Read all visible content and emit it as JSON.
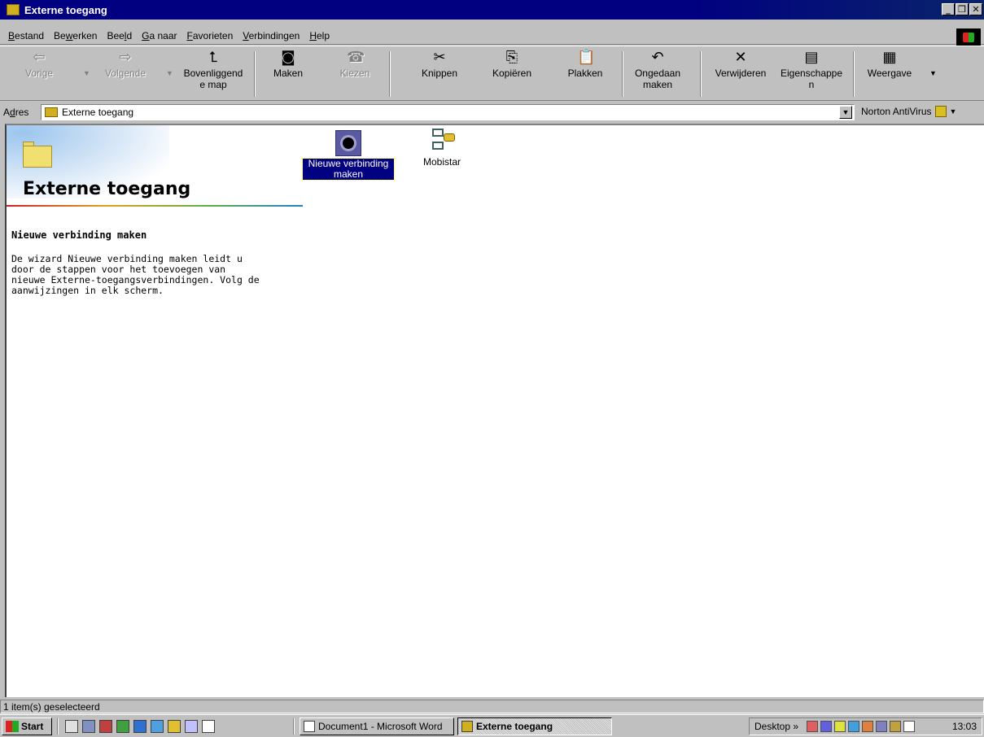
{
  "window": {
    "title": "Externe toegang"
  },
  "menu": [
    {
      "pre": "",
      "ul": "B",
      "post": "estand"
    },
    {
      "pre": "Be",
      "ul": "w",
      "post": "erken"
    },
    {
      "pre": "Bee",
      "ul": "l",
      "post": "d"
    },
    {
      "pre": "",
      "ul": "G",
      "post": "a naar"
    },
    {
      "pre": "",
      "ul": "F",
      "post": "avorieten"
    },
    {
      "pre": "",
      "ul": "V",
      "post": "erbindingen"
    },
    {
      "pre": "",
      "ul": "H",
      "post": "elp"
    }
  ],
  "toolbar": {
    "back": "Vorige",
    "forward": "Volgende",
    "up_line1": "Bovenliggend",
    "up_line2": "e map",
    "create": "Maken",
    "dial": "Kiezen",
    "cut": "Knippen",
    "copy": "Kopiëren",
    "paste": "Plakken",
    "undo_line1": "Ongedaan",
    "undo_line2": "maken",
    "delete": "Verwijderen",
    "props_line1": "Eigenschappe",
    "props_line2": "n",
    "views": "Weergave"
  },
  "address": {
    "label_pre": "A",
    "label_ul": "d",
    "label_post": "res",
    "value": "Externe toegang",
    "norton": "Norton AntiVirus"
  },
  "panel": {
    "title": "Externe toegang",
    "section_title": "Nieuwe verbinding maken",
    "description": "De wizard Nieuwe verbinding maken leidt u\ndoor de stappen voor het toevoegen van\nnieuwe Externe-toegangsverbindingen. Volg de\naanwijzingen in elk scherm."
  },
  "items": [
    {
      "line1": "Nieuwe verbinding",
      "line2": "maken",
      "selected": true
    },
    {
      "line1": "Mobistar",
      "line2": "",
      "selected": false
    }
  ],
  "status": {
    "text": "1 item(s) geselecteerd"
  },
  "taskbar": {
    "start": "Start",
    "tasks": [
      "Document1 - Microsoft Word",
      "Externe toegang"
    ],
    "desktop": "Desktop »",
    "clock": "13:03"
  }
}
